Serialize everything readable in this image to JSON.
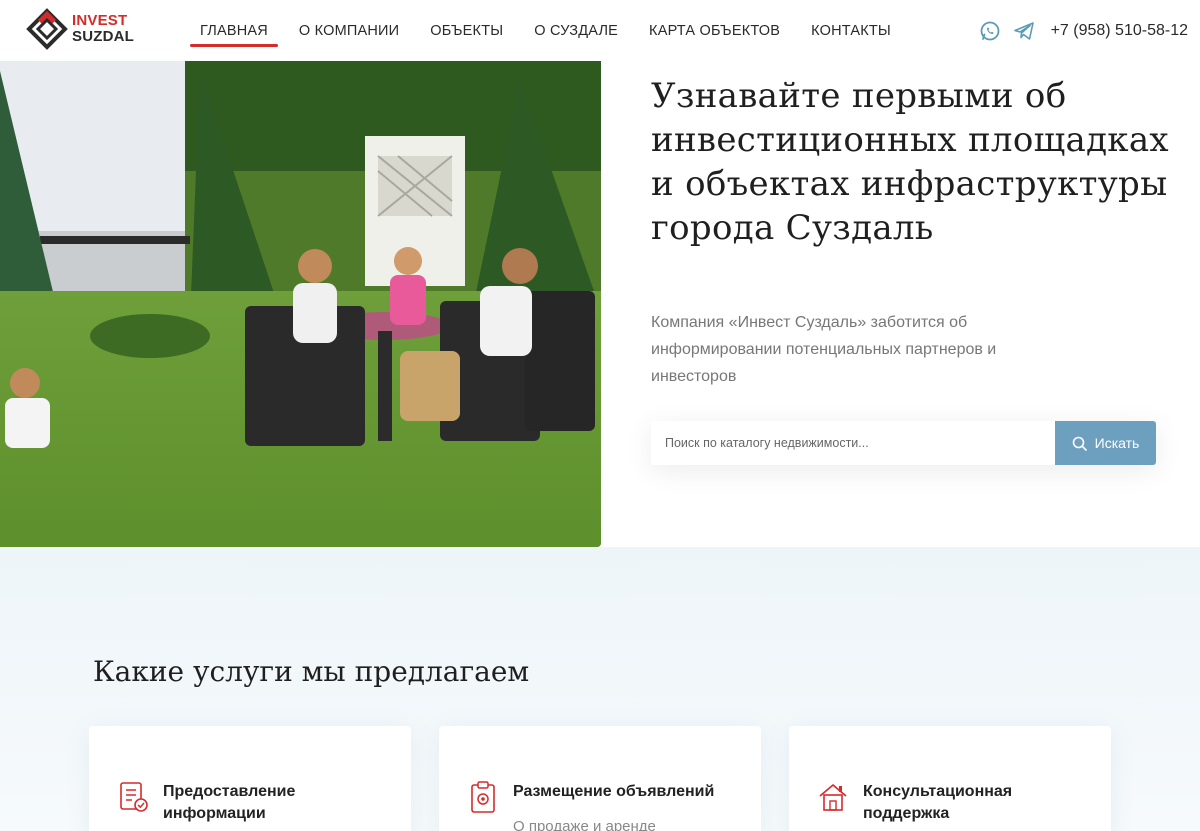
{
  "logo": {
    "line1": "INVEST",
    "line2": "SUZDAL"
  },
  "nav": {
    "items": [
      {
        "label": "ГЛАВНАЯ",
        "active": true
      },
      {
        "label": "О КОМПАНИИ"
      },
      {
        "label": "ОБЪЕКТЫ"
      },
      {
        "label": "О СУЗДАЛЕ"
      },
      {
        "label": "КАРТА ОБЪЕКТОВ"
      },
      {
        "label": "КОНТАКТЫ"
      }
    ]
  },
  "contacts": {
    "phone": "+7 (958) 510-58-12",
    "icons": [
      "whatsapp-icon",
      "telegram-icon"
    ]
  },
  "hero": {
    "title": "Узнавайте первыми об инвестиционных площадках и объектах инфраструктуры города Суздаль",
    "subtitle": "Компания «Инвест Суздаль» заботится об информировании потенциальных партнеров и инвесторов",
    "search": {
      "placeholder": "Поиск по каталогу недвижимости...",
      "button_label": "Искать"
    }
  },
  "services": {
    "title": "Какие услуги мы предлагаем",
    "cards": [
      {
        "title": "Предоставление информации",
        "icon": "document-check-icon",
        "desc": ""
      },
      {
        "title": "Размещение объявлений",
        "icon": "clipboard-settings-icon",
        "desc": "О продаже и аренде"
      },
      {
        "title": "Консультационная поддержка",
        "icon": "house-icon",
        "desc": ""
      }
    ]
  },
  "colors": {
    "accent_red": "#d62b2b",
    "search_button": "#6d9fbe",
    "services_bg": "#eef5f9",
    "text_dark": "#1f1f1f",
    "text_muted": "#777777"
  }
}
